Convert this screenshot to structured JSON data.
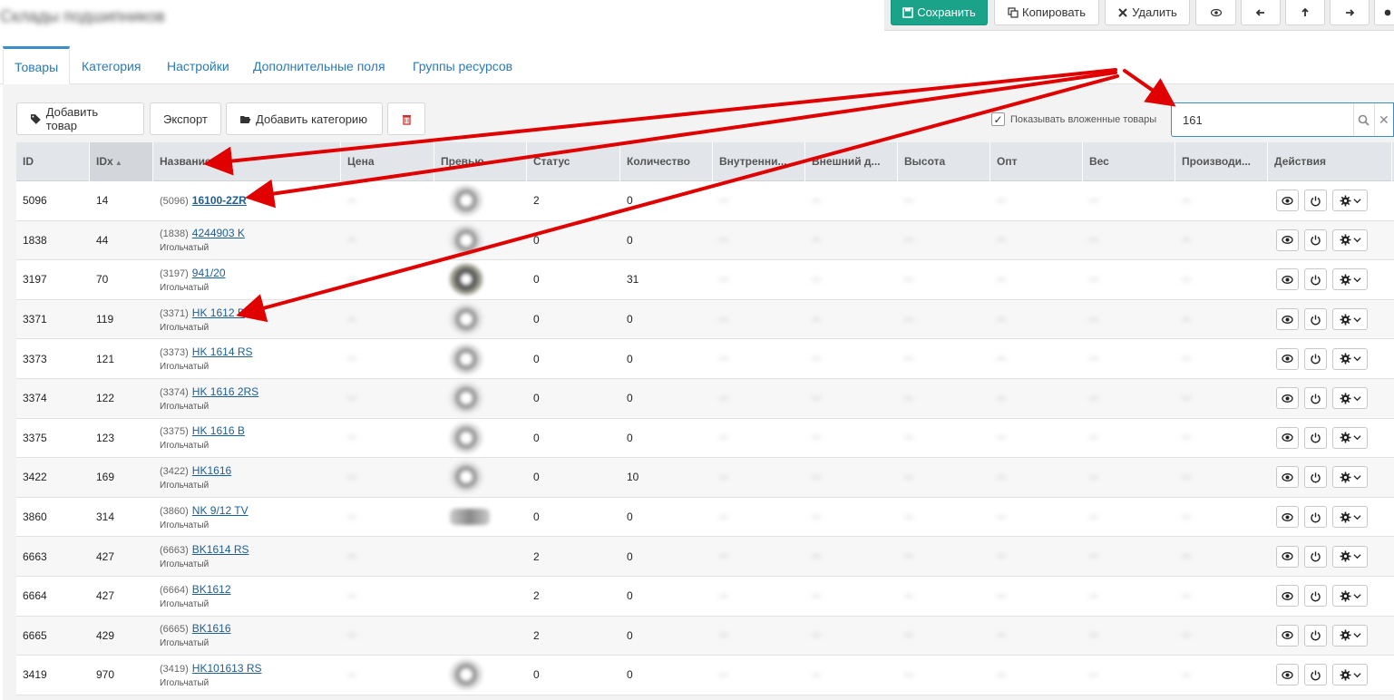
{
  "page": {
    "title": "Склады подшипников"
  },
  "toolbar": {
    "save": "Сохранить",
    "copy": "Копировать",
    "delete": "Удалить"
  },
  "tabs": [
    {
      "label": "Товары",
      "active": true
    },
    {
      "label": "Категория"
    },
    {
      "label": "Настройки"
    },
    {
      "label": "Дополнительные поля"
    },
    {
      "label": "Группы ресурсов"
    }
  ],
  "actions": {
    "add_product": "Добавить товар",
    "export": "Экспорт",
    "add_category": "Добавить категорию"
  },
  "filter": {
    "show_nested_label": "Показывать вложенные товары",
    "show_nested_checked": true,
    "search_value": "161"
  },
  "columns": [
    "ID",
    "IDx",
    "Название",
    "Цена",
    "Превью",
    "Статус",
    "Количество",
    "Внутренни...",
    "Внешний д...",
    "Высота",
    "Опт",
    "Вес",
    "Производи...",
    "Действия"
  ],
  "sort_column": "IDx",
  "rows": [
    {
      "id": "5096",
      "idx": "14",
      "prefix": "(5096)",
      "name": "16100-2ZR",
      "sub": "",
      "status": "2",
      "qty": "0",
      "thumb": "ring"
    },
    {
      "id": "1838",
      "idx": "44",
      "prefix": "(1838)",
      "name": "4244903 K",
      "sub": "Игольчатый",
      "status": "0",
      "qty": "0",
      "thumb": "ring"
    },
    {
      "id": "3197",
      "idx": "70",
      "prefix": "(3197)",
      "name": "941/20",
      "sub": "Игольчатый",
      "status": "0",
      "qty": "31",
      "thumb": "dark"
    },
    {
      "id": "3371",
      "idx": "119",
      "prefix": "(3371)",
      "name": "HK 1612 B",
      "sub": "Игольчатый",
      "status": "0",
      "qty": "0",
      "thumb": "ring"
    },
    {
      "id": "3373",
      "idx": "121",
      "prefix": "(3373)",
      "name": "HK 1614 RS",
      "sub": "Игольчатый",
      "status": "0",
      "qty": "0",
      "thumb": "ring"
    },
    {
      "id": "3374",
      "idx": "122",
      "prefix": "(3374)",
      "name": "HK 1616 2RS",
      "sub": "Игольчатый",
      "status": "0",
      "qty": "0",
      "thumb": "ring"
    },
    {
      "id": "3375",
      "idx": "123",
      "prefix": "(3375)",
      "name": "HK 1616 B",
      "sub": "Игольчатый",
      "status": "0",
      "qty": "0",
      "thumb": "ring"
    },
    {
      "id": "3422",
      "idx": "169",
      "prefix": "(3422)",
      "name": "HK1616",
      "sub": "Игольчатый",
      "status": "0",
      "qty": "10",
      "thumb": "ring"
    },
    {
      "id": "3860",
      "idx": "314",
      "prefix": "(3860)",
      "name": "NK 9/12 TV",
      "sub": "Игольчатый",
      "status": "0",
      "qty": "0",
      "thumb": "wide"
    },
    {
      "id": "6663",
      "idx": "427",
      "prefix": "(6663)",
      "name": "BK1614 RS",
      "sub": "Игольчатый",
      "status": "2",
      "qty": "0",
      "thumb": ""
    },
    {
      "id": "6664",
      "idx": "427",
      "prefix": "(6664)",
      "name": "BK1612",
      "sub": "Игольчатый",
      "status": "2",
      "qty": "0",
      "thumb": ""
    },
    {
      "id": "6665",
      "idx": "429",
      "prefix": "(6665)",
      "name": "BK1616",
      "sub": "Игольчатый",
      "status": "2",
      "qty": "0",
      "thumb": ""
    },
    {
      "id": "3419",
      "idx": "970",
      "prefix": "(3419)",
      "name": "HK101613 RS",
      "sub": "Игольчатый",
      "status": "0",
      "qty": "0",
      "thumb": "ring"
    }
  ],
  "blurred_placeholder": "—",
  "colors": {
    "primary": "#1aa388",
    "link": "#1c5e96",
    "arrow": "#e00000",
    "search_border": "#3a8dcb"
  }
}
